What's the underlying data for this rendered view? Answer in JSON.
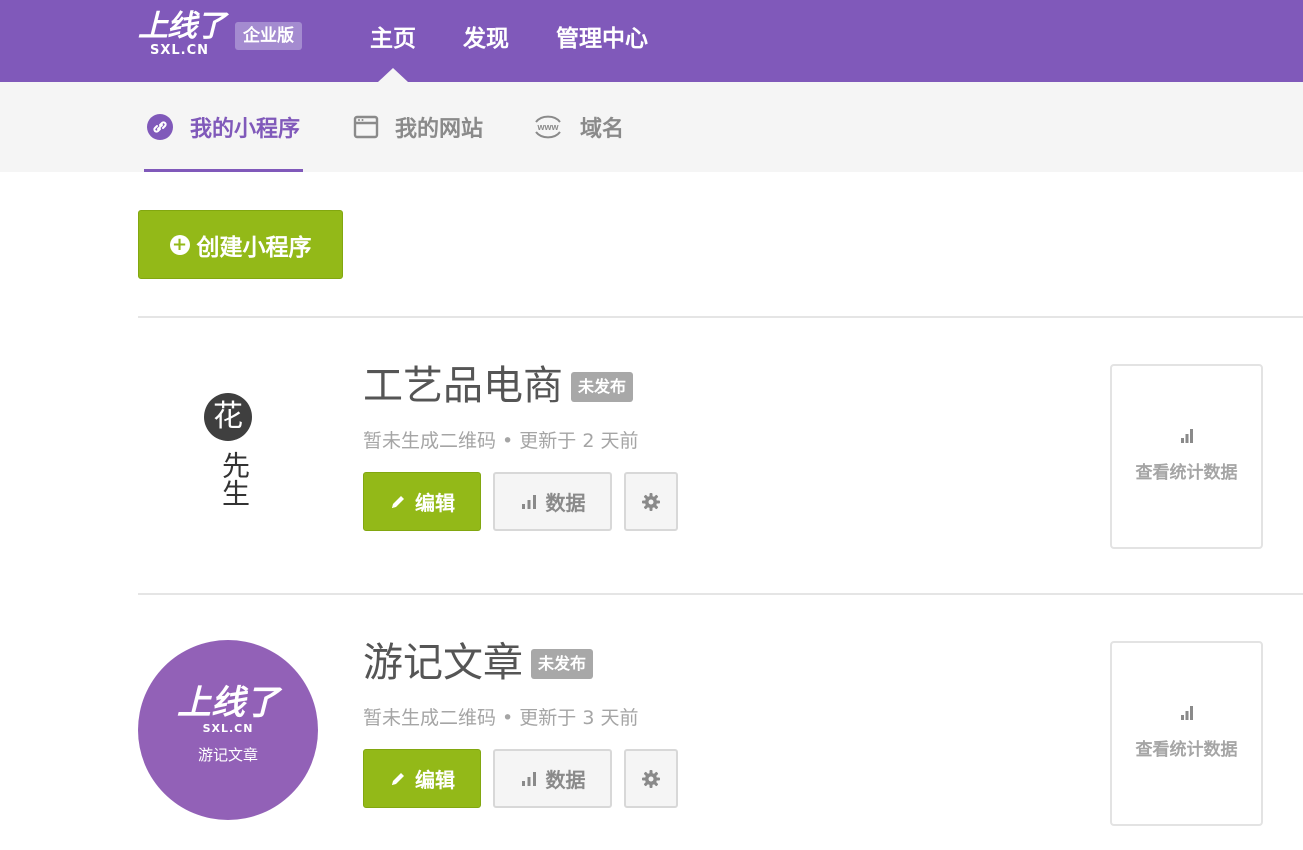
{
  "header": {
    "logo_main": "上线了",
    "logo_sub": "SXL.CN",
    "edition": "企业版",
    "nav": [
      {
        "label": "主页"
      },
      {
        "label": "发现"
      },
      {
        "label": "管理中心"
      }
    ]
  },
  "subnav": {
    "tabs": [
      {
        "label": "我的小程序",
        "icon": "link-circle-icon"
      },
      {
        "label": "我的网站",
        "icon": "browser-window-icon"
      },
      {
        "label": "域名",
        "icon": "www-icon"
      }
    ]
  },
  "create_button": {
    "label": "创建小程序"
  },
  "apps": [
    {
      "title": "工艺品电商",
      "status": "未发布",
      "meta": "暂未生成二维码 • 更新于 2 天前",
      "logo": {
        "type": "flower",
        "glyph": "花",
        "text": "先生"
      },
      "edit_label": "编辑",
      "data_label": "数据",
      "stats_label": "查看统计数据"
    },
    {
      "title": "游记文章",
      "status": "未发布",
      "meta": "暂未生成二维码 • 更新于 3 天前",
      "logo": {
        "type": "circle",
        "main": "上线了",
        "sub": "SXL.CN",
        "name": "游记文章"
      },
      "edit_label": "编辑",
      "data_label": "数据",
      "stats_label": "查看统计数据"
    }
  ],
  "colors": {
    "brand": "#8059ba",
    "action": "#93b918",
    "badge": "#a8a8a8"
  }
}
